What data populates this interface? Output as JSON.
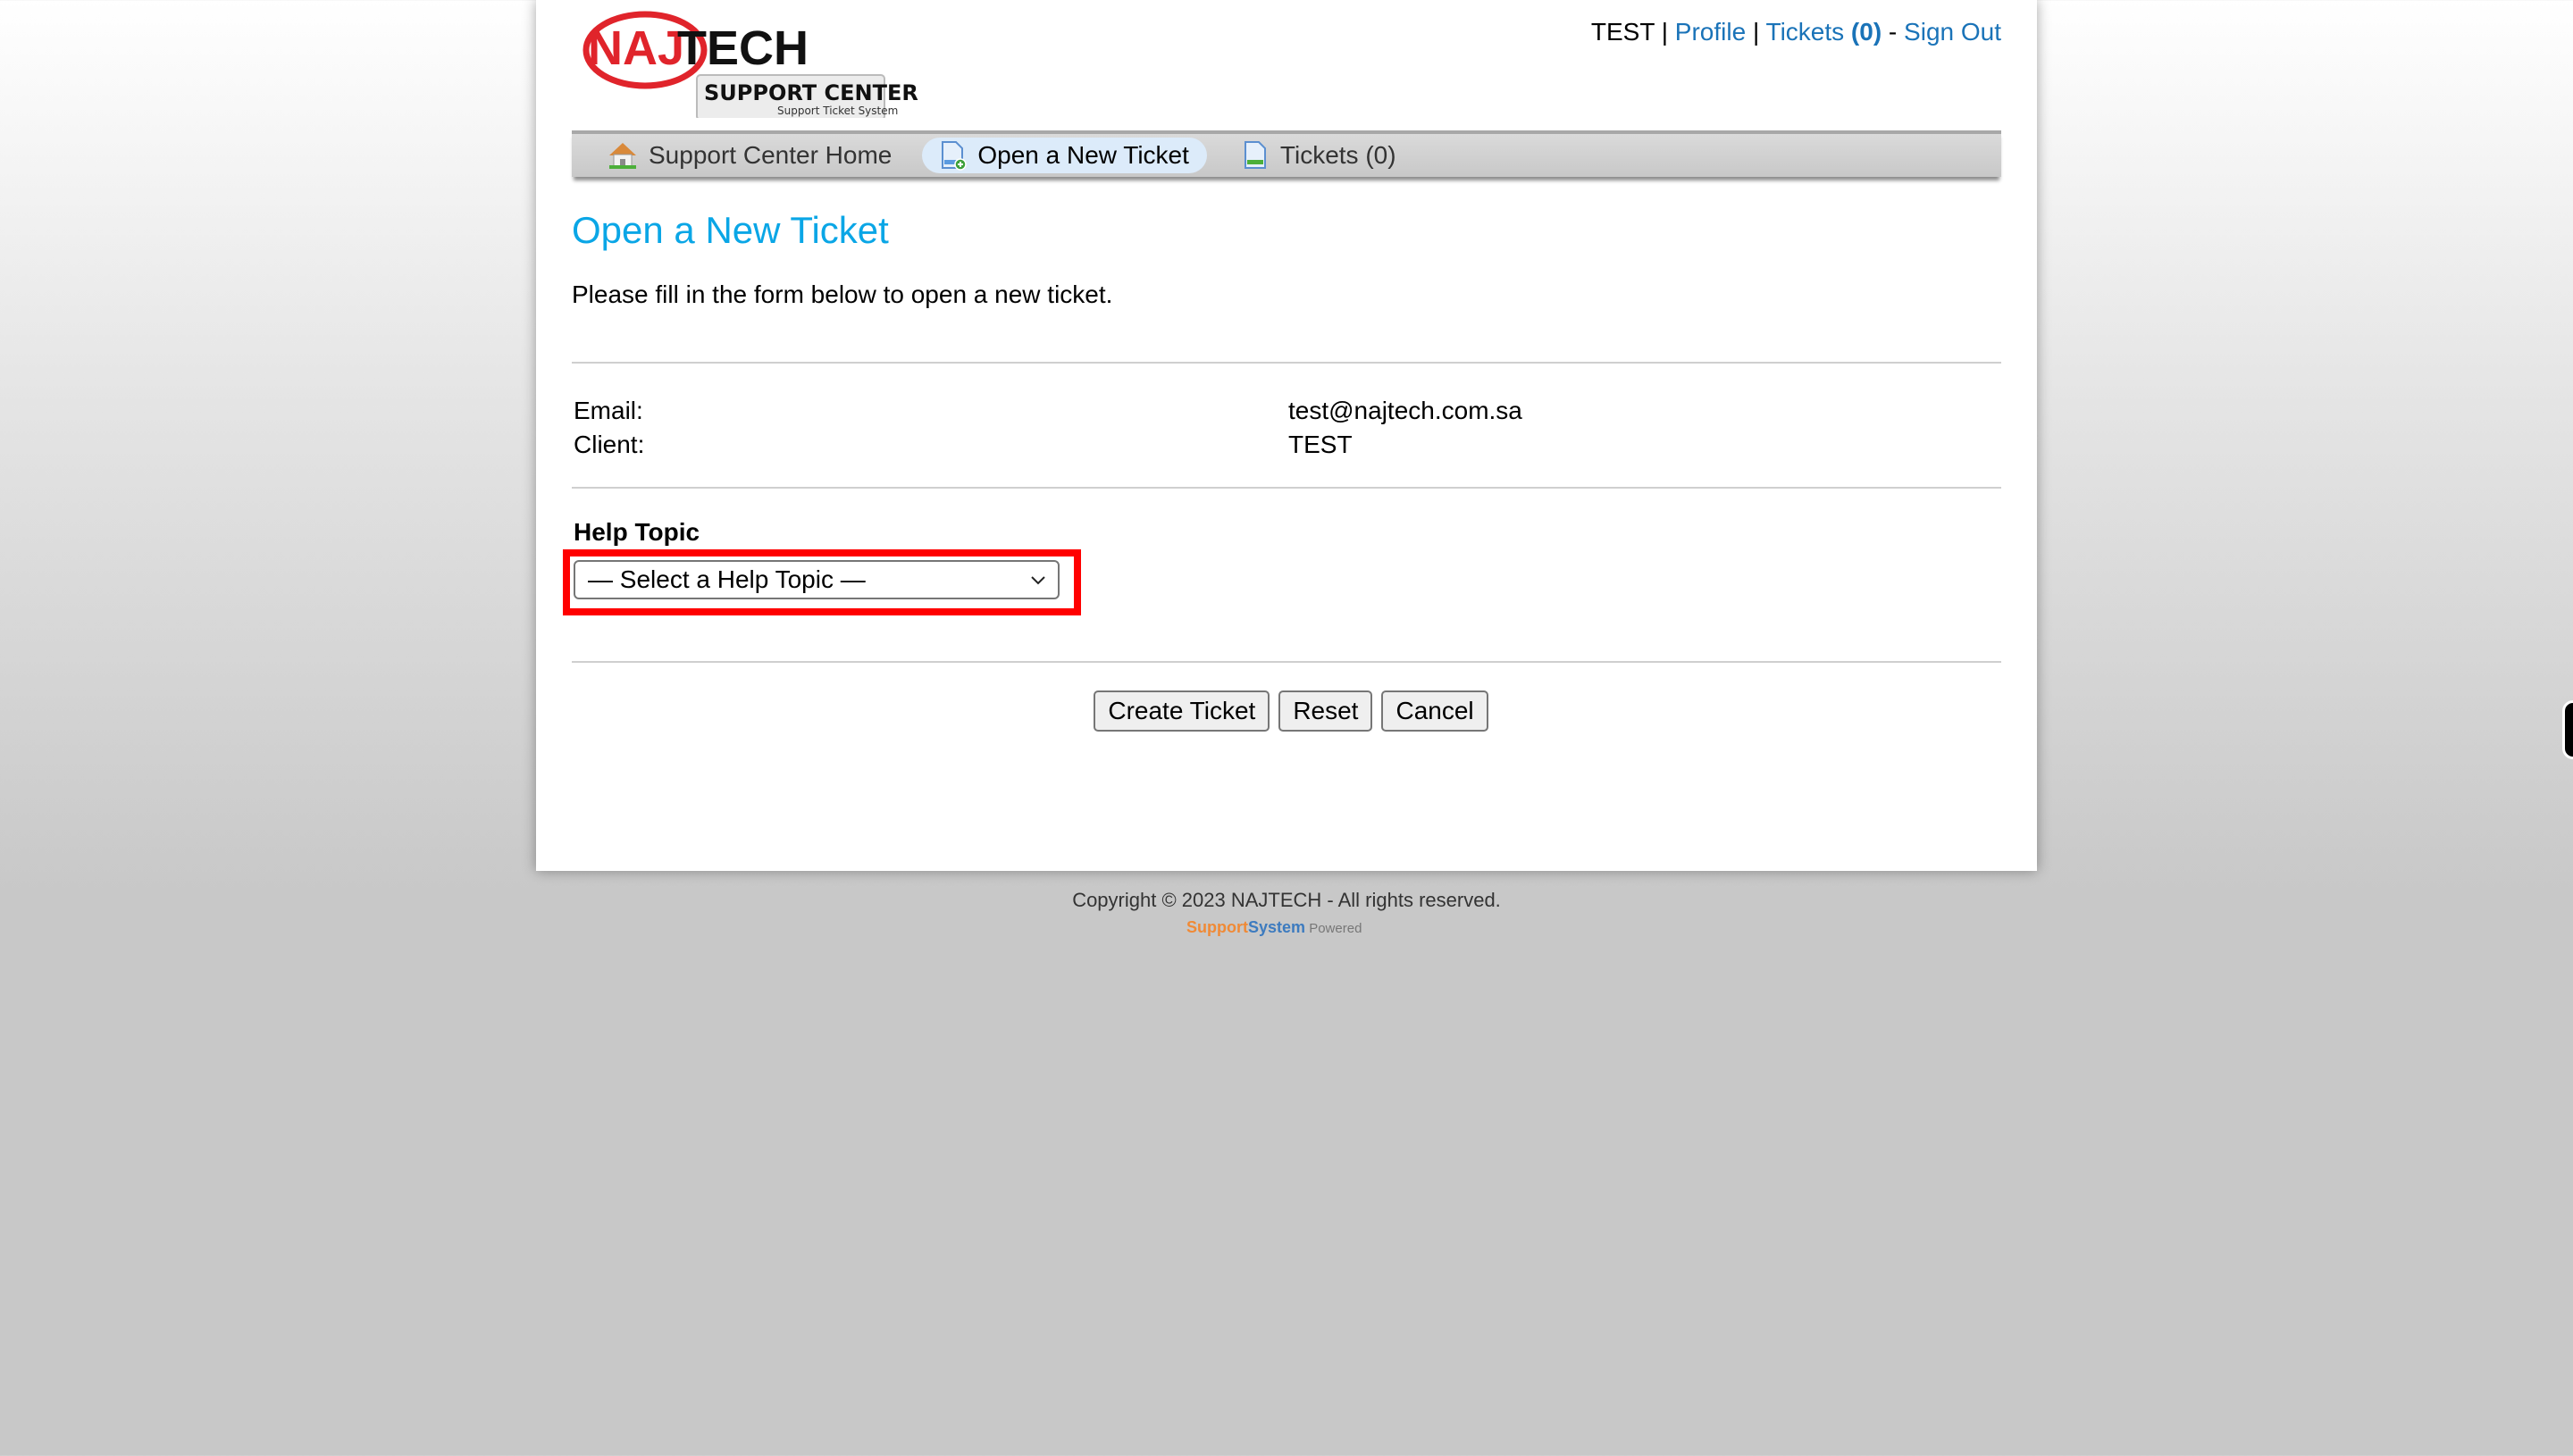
{
  "brand": {
    "logo_word_red": "NAJ",
    "logo_word_black": "TECH",
    "logo_sub_title": "SUPPORT CENTER",
    "logo_sub_caption": "Support Ticket System"
  },
  "user_bar": {
    "username": "TEST",
    "sep1": " | ",
    "profile": "Profile",
    "sep2": " | ",
    "tickets": "Tickets",
    "tickets_count": "(0)",
    "sep3": " - ",
    "sign_out": "Sign Out"
  },
  "nav": {
    "items": [
      {
        "label": "Support Center Home",
        "icon": "home-icon",
        "active": false
      },
      {
        "label": "Open a New Ticket",
        "icon": "new-ticket-icon",
        "active": true
      },
      {
        "label": "Tickets (0)",
        "icon": "tickets-icon",
        "active": false
      }
    ]
  },
  "main": {
    "title": "Open a New Ticket",
    "intro": "Please fill in the form below to open a new ticket.",
    "info": [
      {
        "label": "Email:",
        "value": "test@najtech.com.sa"
      },
      {
        "label": "Client:",
        "value": "TEST"
      }
    ],
    "help_topic": {
      "label": "Help Topic",
      "selected": "— Select a Help Topic —",
      "required_marker": "*"
    },
    "buttons": {
      "create": "Create Ticket",
      "reset": "Reset",
      "cancel": "Cancel"
    }
  },
  "footer": {
    "copyright": "Copyright © 2023 NAJTECH - All rights reserved.",
    "powered_part1": "Support",
    "powered_part2": "System",
    "powered_part3": " Powered"
  },
  "colors": {
    "title": "#0aa6e6",
    "link": "#1a73b8",
    "highlight": "#ff0000"
  }
}
